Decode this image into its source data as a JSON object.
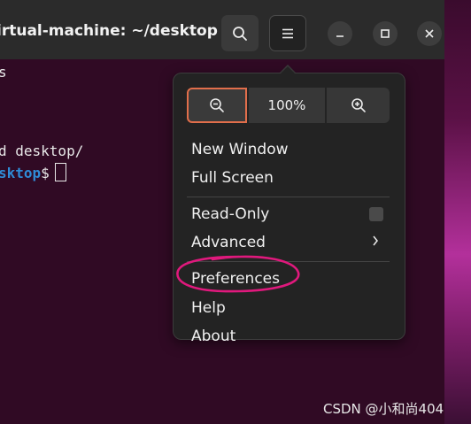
{
  "window": {
    "title": "irtual-machine: ~/desktop"
  },
  "terminal": {
    "lines": [
      "s",
      "d desktop/"
    ],
    "prompt_path": "sktop",
    "prompt_symbol": "$"
  },
  "menu": {
    "zoom_level": "100%",
    "items": [
      {
        "label": "New Window"
      },
      {
        "label": "Full Screen"
      },
      {
        "label": "Read-Only"
      },
      {
        "label": "Advanced"
      },
      {
        "label": "Preferences"
      },
      {
        "label": "Help"
      },
      {
        "label": "About"
      }
    ],
    "read_only_checked": false
  },
  "watermark": "CSDN @小和尚404",
  "colors": {
    "terminal_bg": "#300a24",
    "headerbar_bg": "#2b2b2b",
    "popover_bg": "#232323",
    "accent_focus": "#e16e4b",
    "annotation": "#e0197d",
    "prompt_path": "#2f8bd6"
  },
  "icons": {
    "search": "search-icon",
    "menu": "hamburger-menu-icon",
    "minimize": "minimize-icon",
    "maximize": "maximize-icon",
    "close": "close-icon",
    "zoom_out": "zoom-out-icon",
    "zoom_in": "zoom-in-icon",
    "submenu": "chevron-right-icon"
  }
}
